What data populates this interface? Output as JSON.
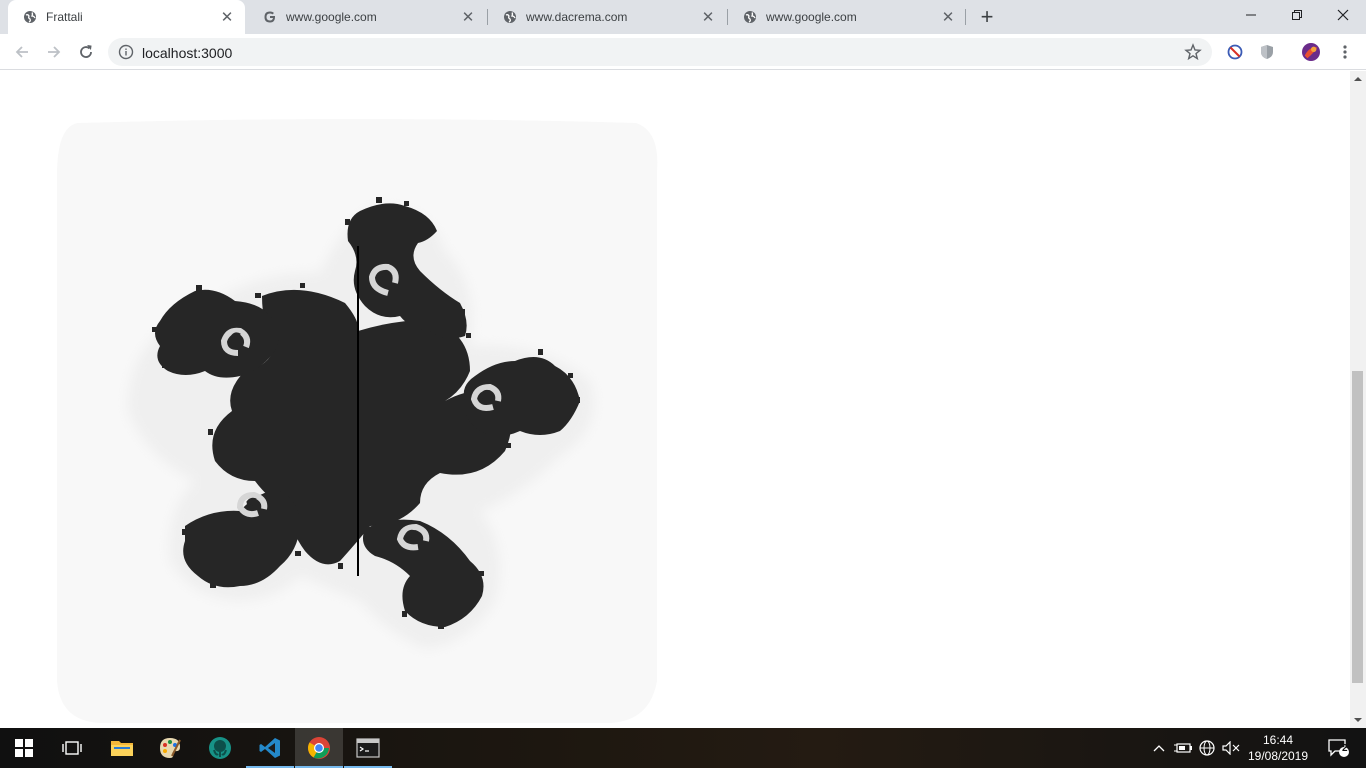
{
  "browser": {
    "tabs": [
      {
        "title": "Frattali",
        "icon": "globe-icon",
        "active": true
      },
      {
        "title": "www.google.com",
        "icon": "google-icon",
        "active": false
      },
      {
        "title": "www.dacrema.com",
        "icon": "globe-icon",
        "active": false
      },
      {
        "title": "www.google.com",
        "icon": "globe-icon",
        "active": false
      }
    ],
    "new_tab": "+",
    "url": "localhost:3000",
    "colors": {
      "tabstrip": "#dee1e6",
      "omnibox": "#f1f3f4",
      "scrollbar_thumb": "#c1c1c1"
    }
  },
  "page": {
    "canvas": {
      "description_color_fractal": "#262626",
      "background_halo": "#f8f8f8",
      "background_inner": "#efefef"
    }
  },
  "taskbar": {
    "apps": [
      {
        "name": "start",
        "icon": "windows-logo-icon"
      },
      {
        "name": "task-view",
        "icon": "task-view-icon"
      },
      {
        "name": "file-explorer",
        "icon": "folder-icon"
      },
      {
        "name": "paint",
        "icon": "palette-icon"
      },
      {
        "name": "gitkraken",
        "icon": "kraken-icon"
      },
      {
        "name": "vscode",
        "icon": "vscode-icon"
      },
      {
        "name": "chrome",
        "icon": "chrome-icon"
      },
      {
        "name": "terminal",
        "icon": "terminal-icon"
      }
    ],
    "clock": {
      "time": "16:44",
      "date": "19/08/2019"
    },
    "notifications": {
      "count": "2"
    }
  }
}
